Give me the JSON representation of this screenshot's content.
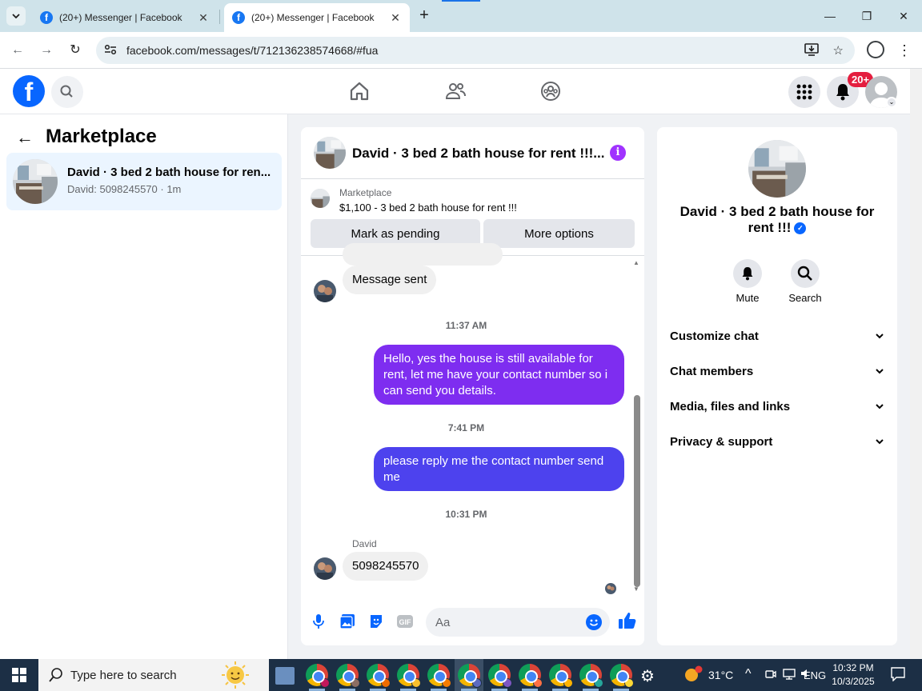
{
  "browser": {
    "tabs": [
      {
        "title": "(20+) Messenger | Facebook",
        "active": false
      },
      {
        "title": "(20+) Messenger | Facebook",
        "active": true
      }
    ],
    "url": "facebook.com/messages/t/712136238574668/#fua",
    "icons": [
      "tab-list-icon",
      "close-icon",
      "new-tab-icon",
      "minimize-icon",
      "restore-icon",
      "back-icon",
      "forward-icon",
      "reload-icon",
      "site-info-icon",
      "install-app-icon",
      "bookmark-star-icon",
      "profile-icon",
      "menu-kebab-icon"
    ]
  },
  "fb_nav": {
    "notification_badge": "20+",
    "icons": [
      "facebook-logo-icon",
      "search-icon",
      "home-icon",
      "friends-icon",
      "groups-icon",
      "menu-grid-icon",
      "bell-icon",
      "avatar-icon"
    ]
  },
  "left": {
    "title": "Marketplace",
    "conversation": {
      "name": "David · 3 bed 2 bath house for ren...",
      "subtitle": "David: 5098245570 · 1m"
    }
  },
  "chat": {
    "header_title": "David · 3 bed 2 bath house for rent !!!...",
    "listing": {
      "label": "Marketplace",
      "price_line": "$1,100 - 3 bed 2 bath house for rent !!!"
    },
    "buttons": {
      "pending": "Mark as pending",
      "more": "More options"
    },
    "messages": {
      "m1": "Message sent",
      "t1": "11:37 AM",
      "m2": "Hello, yes the house is still available for rent, let me have your contact number so i can send you details.",
      "t2": "7:41 PM",
      "m3": "please reply me the contact number send me",
      "t3": "10:31 PM",
      "sender": "David",
      "m4": "5098245570"
    },
    "composer_placeholder": "Aa"
  },
  "right": {
    "name": "David · 3 bed 2 bath house for rent !!!",
    "actions": {
      "mute": "Mute",
      "search": "Search"
    },
    "sections": [
      "Customize chat",
      "Chat members",
      "Media, files and links",
      "Privacy & support"
    ]
  },
  "taskbar": {
    "search_placeholder": "Type here to search",
    "temperature": "31°C",
    "language": "ENG",
    "time": "10:32 PM",
    "date": "10/3/2025"
  },
  "colors": {
    "facebook_blue": "#0866ff",
    "bubble_purple": "#7e2df0",
    "bubble_blue_violet": "#4d42ee",
    "incoming_bubble": "#f0f0f0",
    "notification_red": "#e41e3f",
    "taskbar": "#1c2f45"
  }
}
